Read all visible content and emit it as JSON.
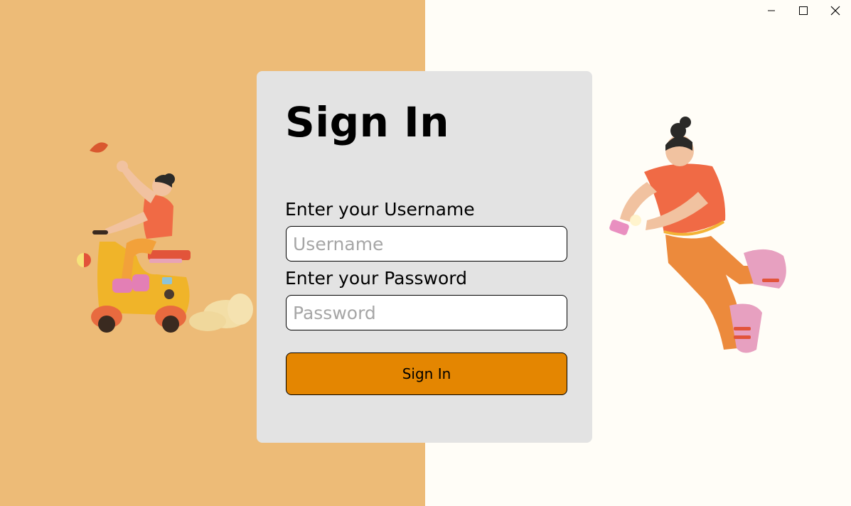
{
  "colors": {
    "left_bg": "#edbb77",
    "right_bg": "#fffdf7",
    "card_bg": "#e3e3e3",
    "button_bg": "#e48601"
  },
  "window_controls": {
    "minimize_icon": "minimize-icon",
    "maximize_icon": "maximize-icon",
    "close_icon": "close-icon"
  },
  "login": {
    "title": "Sign In",
    "username_label": "Enter your Username",
    "username_placeholder": "Username",
    "username_value": "",
    "password_label": "Enter your Password",
    "password_placeholder": "Password",
    "password_value": "",
    "submit_label": "Sign In"
  },
  "illustrations": {
    "left": "scooter-rider-illustration",
    "right": "floating-person-phone-illustration"
  }
}
